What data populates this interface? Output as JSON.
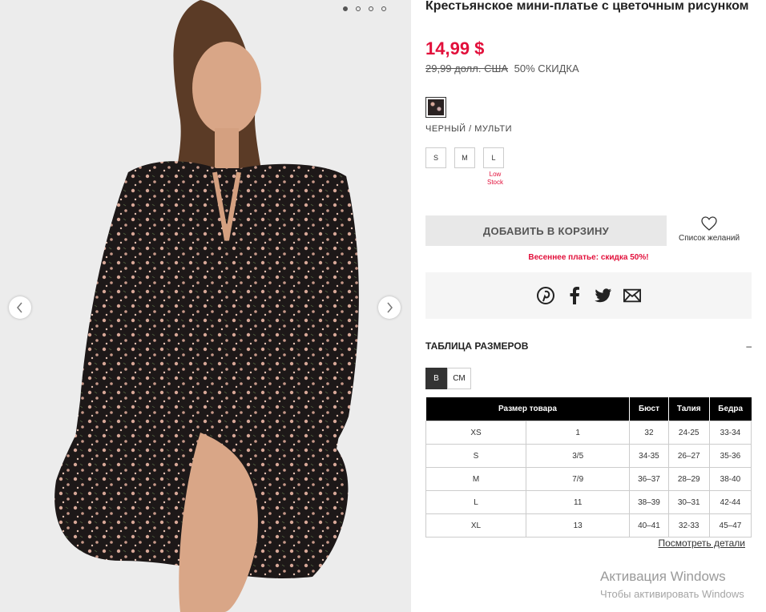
{
  "gallery": {
    "image_alt": "Model wearing black floral peasant mini dress",
    "dots_count": 4,
    "prev_icon": "chevron-left-icon",
    "next_icon": "chevron-right-icon"
  },
  "product": {
    "title": "Крестьянское мини-платье с цветочным рисунком",
    "price": "14,99 $",
    "old_price": "29,99 долл. США",
    "discount": "50% СКИДКА",
    "color_name": "ЧЕРНЫЙ / МУЛЬТИ",
    "sizes": [
      "S",
      "M",
      "L"
    ],
    "low_stock": "Low Stock"
  },
  "actions": {
    "add_to_cart": "ДОБАВИТЬ В КОРЗИНУ",
    "wishlist": "Список желаний",
    "promo": "Весеннее платье: скидка 50%!"
  },
  "share": {
    "icons": [
      "pinterest-icon",
      "facebook-icon",
      "twitter-icon",
      "email-icon"
    ]
  },
  "size_chart": {
    "heading": "ТАБЛИЦА РАЗМЕРОВ",
    "toggle": "–",
    "units": [
      "В",
      "СМ"
    ],
    "headers": [
      "Размер товара",
      "Бюст",
      "Талия",
      "Бедра"
    ],
    "rows": [
      [
        "XS",
        "1",
        "32",
        "24-25",
        "33-34"
      ],
      [
        "S",
        "3/5",
        "34-35",
        "26–27",
        "35-36"
      ],
      [
        "M",
        "7/9",
        "36–37",
        "28–29",
        "38-40"
      ],
      [
        "L",
        "11",
        "38–39",
        "30–31",
        "42-44"
      ],
      [
        "XL",
        "13",
        "40–41",
        "32-33",
        "45–47"
      ]
    ],
    "details_link": "Посмотреть детали"
  },
  "os_watermark": {
    "line1": "Активация Windows",
    "line2": "Чтобы активировать Windows"
  },
  "colors": {
    "accent": "#e2103b",
    "button_bg": "#e8e8e8"
  }
}
